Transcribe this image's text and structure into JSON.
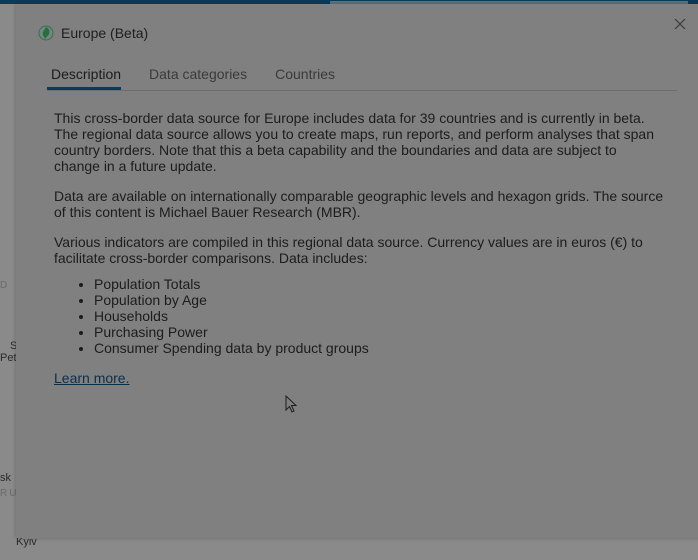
{
  "map": {
    "labels": [
      "D",
      "S",
      "Pete",
      "sk",
      "RU",
      "Kyiv"
    ]
  },
  "dialog": {
    "title": "Europe (Beta)",
    "close_icon": "close-icon",
    "tabs": [
      {
        "label": "Description",
        "active": true
      },
      {
        "label": "Data categories",
        "active": false
      },
      {
        "label": "Countries",
        "active": false
      }
    ],
    "paragraphs": [
      "This cross-border data source for Europe includes data for 39 countries and is currently in beta. The regional data source allows you to create maps, run reports, and perform analyses that span country borders. Note that this a beta capability and the boundaries and data are subject to change in a future update.",
      "Data are available on internationally comparable geographic levels and hexagon grids. The source of this content is Michael Bauer Research (MBR).",
      "Various indicators are compiled in this regional data source. Currency values are in euros (€) to facilitate cross-border comparisons. Data includes:"
    ],
    "list": [
      "Population Totals",
      "Population by Age",
      "Households",
      "Purchasing Power",
      "Consumer Spending data by product groups"
    ],
    "learn_more": "Learn more."
  }
}
